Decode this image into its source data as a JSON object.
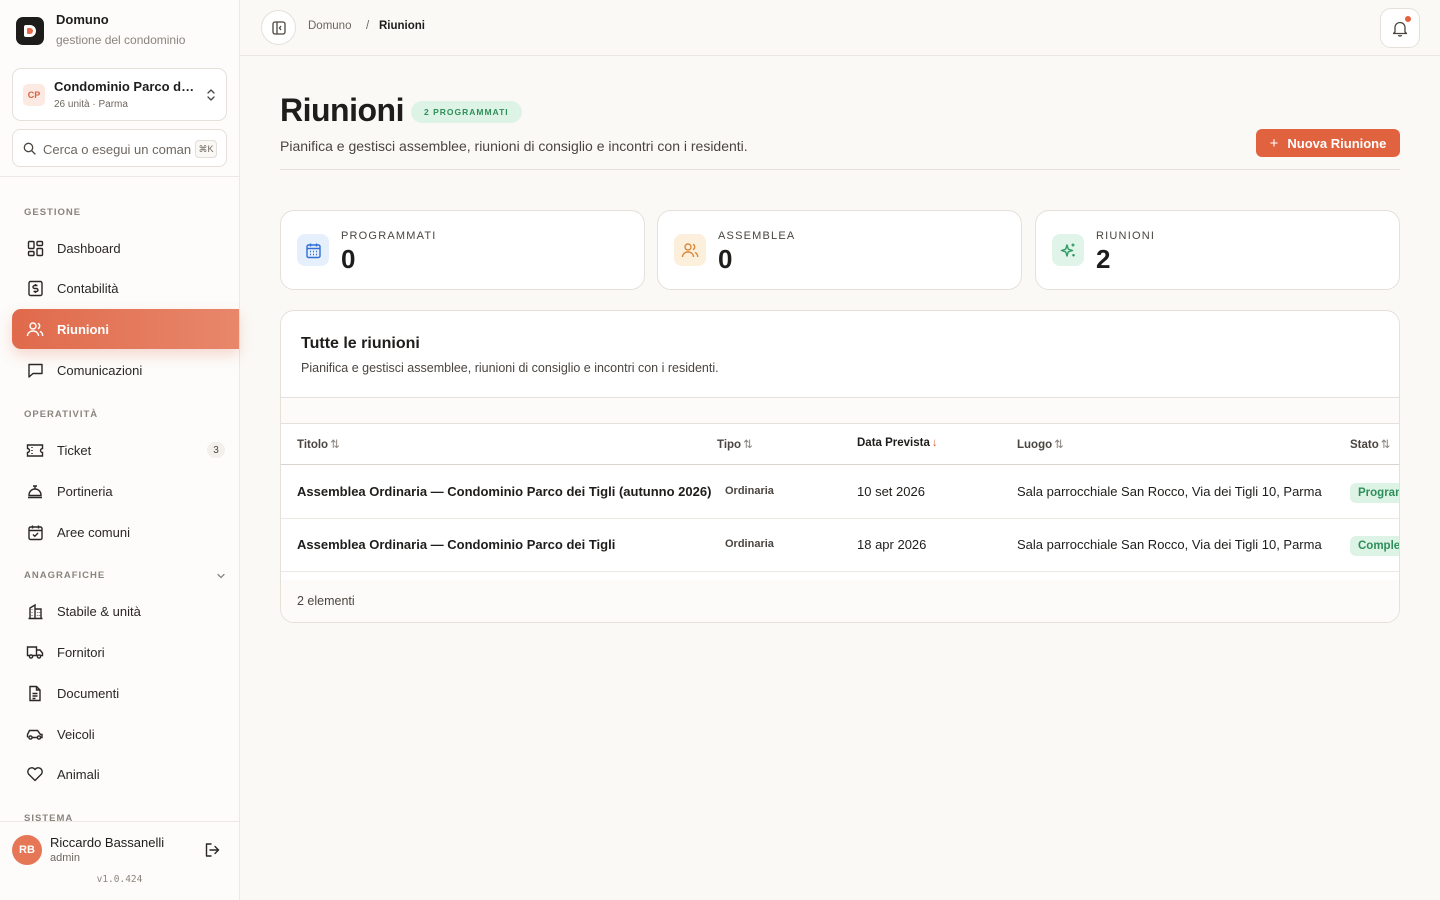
{
  "brand": {
    "name": "Domuno",
    "subtitle": "gestione del condominio"
  },
  "condo": {
    "initials": "CP",
    "name": "Condominio Parco dei Tigli",
    "meta": "26 unità · Parma"
  },
  "search": {
    "placeholder": "Cerca o esegui un comando",
    "shortcut": "⌘K"
  },
  "nav": {
    "sections": {
      "gestione": "GESTIONE",
      "operativita": "OPERATIVITÀ",
      "anagrafiche": "ANAGRAFICHE",
      "sistema": "SISTEMA"
    },
    "items": [
      {
        "label": "Dashboard",
        "icon": "dashboard-icon"
      },
      {
        "label": "Contabilità",
        "icon": "accounting-icon"
      },
      {
        "label": "Riunioni",
        "icon": "users-icon",
        "active": true
      },
      {
        "label": "Comunicazioni",
        "icon": "message-icon"
      },
      {
        "label": "Ticket",
        "icon": "ticket-icon",
        "count": "3"
      },
      {
        "label": "Portineria",
        "icon": "concierge-bell-icon"
      },
      {
        "label": "Aree comuni",
        "icon": "calendar-check-icon"
      },
      {
        "label": "Stabile & unità",
        "icon": "building-icon"
      },
      {
        "label": "Fornitori",
        "icon": "truck-icon"
      },
      {
        "label": "Documenti",
        "icon": "document-icon"
      },
      {
        "label": "Veicoli",
        "icon": "car-icon"
      },
      {
        "label": "Animali",
        "icon": "heart-icon"
      }
    ]
  },
  "user": {
    "initials": "RB",
    "name": "Riccardo Bassanelli",
    "role": "admin",
    "version": "v1.0.424"
  },
  "breadcrumb": {
    "root": "Domuno",
    "separator": "/",
    "current": "Riunioni"
  },
  "page": {
    "title": "Riunioni",
    "badge": "2 PROGRAMMATI",
    "subtitle": "Pianifica e gestisci assemblee, riunioni di consiglio e incontri con i residenti.",
    "new_button": "Nuova Riunione"
  },
  "stats": [
    {
      "label": "PROGRAMMATI",
      "value": "0",
      "icon": "calendar-icon",
      "color": "#2f6fd6",
      "bg": "#e6effc"
    },
    {
      "label": "ASSEMBLEA",
      "value": "0",
      "icon": "users-icon",
      "color": "#d9893a",
      "bg": "#fcefdc"
    },
    {
      "label": "RIUNIONI",
      "value": "2",
      "icon": "sparkles-icon",
      "color": "#2f9a63",
      "bg": "#e0f4e9"
    }
  ],
  "table": {
    "title": "Tutte le riunioni",
    "subtitle": "Pianifica e gestisci assemblee, riunioni di consiglio e incontri con i residenti.",
    "columns": [
      "Titolo",
      "Tipo",
      "Data Prevista",
      "Luogo",
      "Stato"
    ],
    "rows": [
      {
        "titolo": "Assemblea Ordinaria — Condominio Parco dei Tigli (autunno 2026)",
        "tipo": "Ordinaria",
        "data": "10 set 2026",
        "luogo": "Sala parrocchiale San Rocco, Via dei Tigli 10, Parma",
        "stato": "Programmata"
      },
      {
        "titolo": "Assemblea Ordinaria — Condominio Parco dei Tigli",
        "tipo": "Ordinaria",
        "data": "18 apr 2026",
        "luogo": "Sala parrocchiale San Rocco, Via dei Tigli 10, Parma",
        "stato": "Completata"
      }
    ],
    "footer": "2 elementi"
  }
}
